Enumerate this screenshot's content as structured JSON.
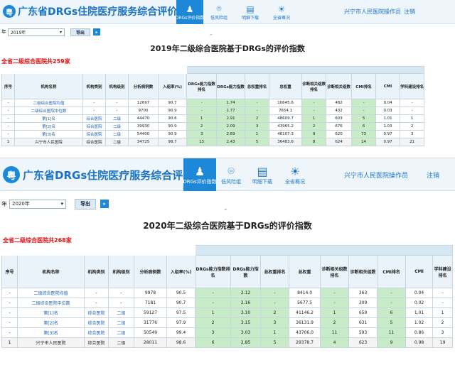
{
  "app": {
    "logo_char": "粤",
    "title": "广东省DRGs住院医疗服务综合评价系统",
    "user": "兴宁市人民医院操作员",
    "logout": "注销",
    "nav": [
      {
        "label": "DRGs评价指数",
        "icon": "person-chart-icon",
        "active": true
      },
      {
        "label": "低风险组",
        "icon": "location-pin-icon",
        "active": false
      },
      {
        "label": "明细下载",
        "icon": "document-download-icon",
        "active": false
      },
      {
        "label": "全省概况",
        "icon": "sun-overview-icon",
        "active": false
      }
    ],
    "year_label": "年",
    "export_label": "导出"
  },
  "colors": {
    "brand": "#1e88d8",
    "highlight_green": "#c8ecc8",
    "alert_red": "#e01010"
  },
  "columns": [
    "序号",
    "机构名称",
    "机构类别",
    "机构级别",
    "分析病例数",
    "入组率(%)",
    "DRGs能力指数排名",
    "DRGs能力指数",
    "总权重排名",
    "总权重",
    "诊断相关组数排名",
    "诊断相关组数",
    "CMI排名",
    "CMI",
    "学科建设排名"
  ],
  "panels": [
    {
      "year": "2019年",
      "title": "2019年二级综合医院基于DRGs的评价指数",
      "count_text": "全省二级综合医院共259家",
      "rows": [
        [
          "-",
          "二级综合医院均值",
          "-",
          "-",
          "12697",
          "90.7",
          "-",
          "1.74",
          "-",
          "10645.6",
          "-",
          "482",
          "-",
          "0.04",
          "-"
        ],
        [
          "-",
          "二级综合医院中位数",
          "-",
          "-",
          "9700",
          "90.9",
          "-",
          "1.77",
          "-",
          "7654.1",
          "-",
          "432",
          "-",
          "0.03",
          "-"
        ],
        [
          "-",
          "第[1]名",
          "综合医院",
          "二级",
          "44470",
          "90.6",
          "1",
          "2.91",
          "2",
          "48609.7",
          "1",
          "603",
          "5",
          "1.01",
          "1"
        ],
        [
          "-",
          "第[2]名",
          "综合医院",
          "二级",
          "39930",
          "90.9",
          "2",
          "2.09",
          "3",
          "43965.2",
          "2",
          "676",
          "6",
          "1.03",
          "2"
        ],
        [
          "-",
          "第[3]名",
          "综合医院",
          "二级",
          "54400",
          "90.9",
          "3",
          "2.69",
          "1",
          "46107.3",
          "9",
          "620",
          "73",
          "0.97",
          "3"
        ],
        [
          "1",
          "兴宁市人民医院",
          "综合医院",
          "二级",
          "34725",
          "98.7",
          "13",
          "2.43",
          "5",
          "36483.6",
          "8",
          "624",
          "14",
          "0.97",
          "21"
        ]
      ]
    },
    {
      "year": "2020年",
      "title": "2020年二级综合医院基于DRGs的评价指数",
      "count_text": "全省二级综合医院共268家",
      "rows": [
        [
          "-",
          "二级综合医院均值",
          "-",
          "-",
          "9978",
          "90.5",
          "-",
          "2.12",
          "-",
          "8414.0",
          "-",
          "363",
          "-",
          "0.04",
          "-"
        ],
        [
          "-",
          "二级综合医院中位数",
          "-",
          "-",
          "7181",
          "90.7",
          "-",
          "2.16",
          "-",
          "5677.5",
          "-",
          "309",
          "-",
          "0.02",
          "-"
        ],
        [
          "-",
          "第[1]名",
          "综合医院",
          "二级",
          "59127",
          "97.5",
          "1",
          "3.10",
          "2",
          "41146.2",
          "1",
          "659",
          "6",
          "1.01",
          "1"
        ],
        [
          "-",
          "第[2]名",
          "综合医院",
          "二级",
          "31776",
          "97.9",
          "2",
          "3.15",
          "3",
          "36131.9",
          "2",
          "631",
          "5",
          "1.02",
          "2"
        ],
        [
          "-",
          "第[3]名",
          "综合医院",
          "二级",
          "50549",
          "99.4",
          "3",
          "3.03",
          "1",
          "43706.0",
          "11",
          "593",
          "11",
          "0.86",
          "3"
        ],
        [
          "1",
          "兴宁市人民医院",
          "综合医院",
          "二级",
          "28011",
          "98.6",
          "6",
          "2.85",
          "5",
          "29378.7",
          "4",
          "623",
          "9",
          "0.98",
          "19"
        ]
      ]
    }
  ]
}
